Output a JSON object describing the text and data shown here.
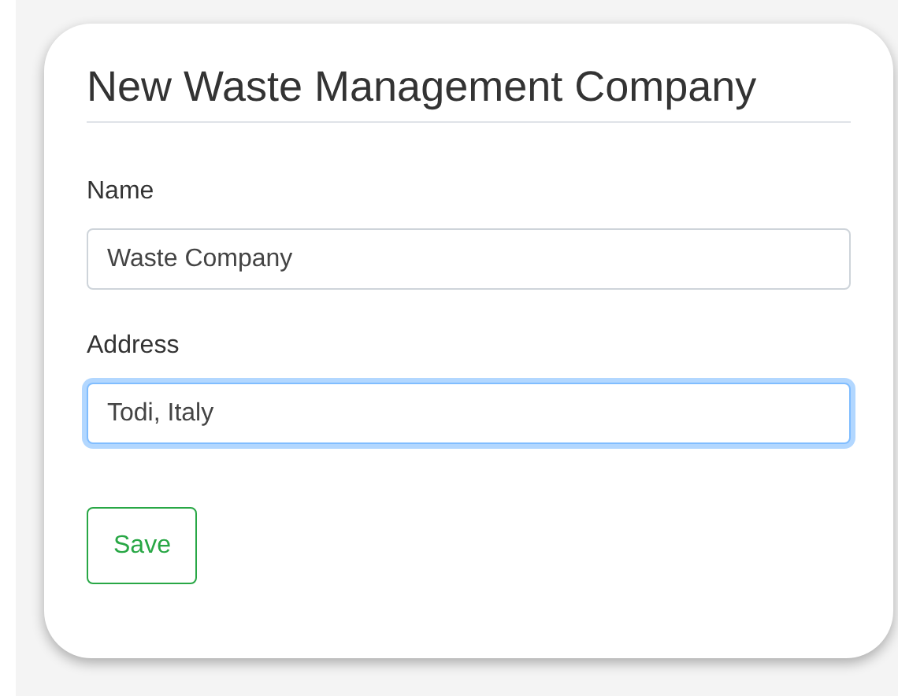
{
  "form": {
    "title": "New Waste Management Company",
    "fields": [
      {
        "label": "Name",
        "value": "Waste Company",
        "focused": false
      },
      {
        "label": "Address",
        "value": "Todi, Italy",
        "focused": true
      }
    ],
    "buttons": [
      "Save"
    ]
  }
}
